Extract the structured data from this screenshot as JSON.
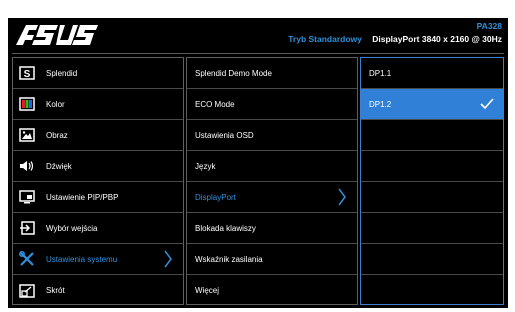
{
  "header": {
    "logo_text": "ASUS",
    "model": "PA328",
    "mode": "Tryb Standardowy",
    "input_info": "DisplayPort  3840 x 2160 @ 30Hz"
  },
  "main_menu": [
    {
      "label": "Splendid",
      "icon": "splendid-s-icon"
    },
    {
      "label": "Kolor",
      "icon": "color-bars-icon"
    },
    {
      "label": "Obraz",
      "icon": "picture-icon"
    },
    {
      "label": "Dźwięk",
      "icon": "speaker-icon"
    },
    {
      "label": "Ustawienie PIP/PBP",
      "icon": "pip-icon"
    },
    {
      "label": "Wybór wejścia",
      "icon": "input-select-icon"
    },
    {
      "label": "Ustawienia systemu",
      "icon": "wrench-screwdriver-icon",
      "active": true
    },
    {
      "label": "Skrót",
      "icon": "shortcut-icon"
    }
  ],
  "submenu": [
    {
      "label": "Splendid Demo Mode"
    },
    {
      "label": "ECO Mode"
    },
    {
      "label": "Ustawienia OSD"
    },
    {
      "label": "Język"
    },
    {
      "label": "DisplayPort",
      "active": true
    },
    {
      "label": "Blokada klawiszy"
    },
    {
      "label": "Wskaźnik zasilania"
    },
    {
      "label": "Więcej"
    }
  ],
  "options": [
    {
      "label": "DP1.1"
    },
    {
      "label": "DP1.2",
      "selected": true
    },
    {
      "label": ""
    },
    {
      "label": ""
    },
    {
      "label": ""
    },
    {
      "label": ""
    },
    {
      "label": ""
    },
    {
      "label": ""
    }
  ],
  "colors": {
    "accent": "#2f8fd8",
    "selected_bg": "#2f80d6",
    "background": "#000000"
  }
}
